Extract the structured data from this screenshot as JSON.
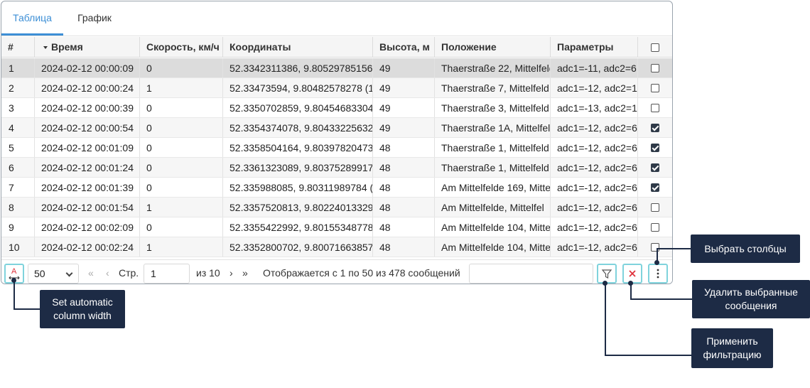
{
  "tabs": [
    {
      "label": "Таблица",
      "active": true
    },
    {
      "label": "График",
      "active": false
    }
  ],
  "table": {
    "columns": [
      "#",
      "Время",
      "Скорость, км/ч",
      "Координаты",
      "Высота, м",
      "Положение",
      "Параметры"
    ],
    "sort_column": "Время",
    "sort_direction": "desc",
    "rows": [
      {
        "n": "1",
        "time": "2024-02-12 00:00:09",
        "speed": "0",
        "coords": "52.3342311386, 9.80529785156",
        "alt": "49",
        "place": "Thaerstraße 22, Mittelfelde",
        "params": "adc1=-11, adc2=6,",
        "checked": false,
        "selected": true
      },
      {
        "n": "2",
        "time": "2024-02-12 00:00:24",
        "speed": "1",
        "coords": "52.33473594, 9.80482578278 (1",
        "alt": "49",
        "place": "Thaerstraße 7, Mittelfeld",
        "params": "adc1=-12, adc2=1",
        "checked": false,
        "selected": false
      },
      {
        "n": "3",
        "time": "2024-02-12 00:00:39",
        "speed": "0",
        "coords": "52.3350702859, 9.80454683304",
        "alt": "49",
        "place": "Thaerstraße 3, Mittelfeld",
        "params": "adc1=-13, adc2=1",
        "checked": false,
        "selected": false
      },
      {
        "n": "4",
        "time": "2024-02-12 00:00:54",
        "speed": "0",
        "coords": "52.3354374078, 9.80433225632",
        "alt": "49",
        "place": "Thaerstraße 1A, Mittelfel",
        "params": "adc1=-12, adc2=6",
        "checked": true,
        "selected": false
      },
      {
        "n": "5",
        "time": "2024-02-12 00:01:09",
        "speed": "0",
        "coords": "52.3358504164, 9.80397820473",
        "alt": "48",
        "place": "Thaerstraße 1, Mittelfeld",
        "params": "adc1=-12, adc2=6",
        "checked": true,
        "selected": false
      },
      {
        "n": "6",
        "time": "2024-02-12 00:01:24",
        "speed": "0",
        "coords": "52.3361323089, 9.80375289917",
        "alt": "48",
        "place": "Thaerstraße 1, Mittelfeld",
        "params": "adc1=-12, adc2=6",
        "checked": true,
        "selected": false
      },
      {
        "n": "7",
        "time": "2024-02-12 00:01:39",
        "speed": "0",
        "coords": "52.335988085, 9.80311989784 (",
        "alt": "48",
        "place": "Am Mittelfelde 169, Mitte",
        "params": "adc1=-12, adc2=6",
        "checked": true,
        "selected": false
      },
      {
        "n": "8",
        "time": "2024-02-12 00:01:54",
        "speed": "1",
        "coords": "52.3357520813, 9.80224013329",
        "alt": "48",
        "place": "Am Mittelfelde, Mittelfel",
        "params": "adc1=-12, adc2=6",
        "checked": false,
        "selected": false
      },
      {
        "n": "9",
        "time": "2024-02-12 00:02:09",
        "speed": "0",
        "coords": "52.3355422992, 9.80155348778",
        "alt": "48",
        "place": "Am Mittelfelde 104, Mitte",
        "params": "adc1=-12, adc2=6",
        "checked": false,
        "selected": false
      },
      {
        "n": "10",
        "time": "2024-02-12 00:02:24",
        "speed": "1",
        "coords": "52.3352800702, 9.80071663857",
        "alt": "48",
        "place": "Am Mittelfelde 104, Mitte",
        "params": "adc1=-12, adc2=6",
        "checked": false,
        "selected": false
      }
    ]
  },
  "toolbar": {
    "page_size": "50",
    "page_label": "Стр.",
    "page_value": "1",
    "page_of": "из 10",
    "summary": "Отображается с 1 по 50 из 478 сообщений",
    "filter_value": ""
  },
  "callouts": {
    "auto_width": "Set automatic column width",
    "choose_columns": "Выбрать столбцы",
    "delete_selected": "Удалить выбранные сообщения",
    "apply_filter": "Применить фильтрацию"
  },
  "colors": {
    "accent": "#3d8fd6",
    "callout_bg": "#1d2b45",
    "button_border": "#7fd3dc",
    "delete_icon": "#e0323c"
  }
}
